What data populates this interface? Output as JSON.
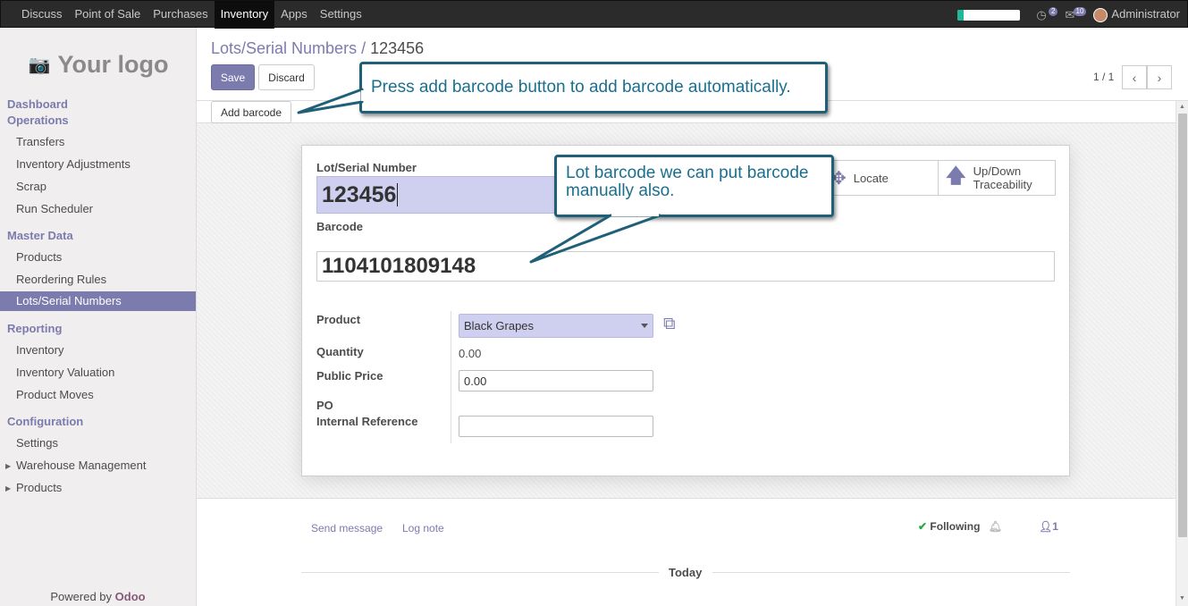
{
  "topbar": {
    "menu": [
      "Discuss",
      "Point of Sale",
      "Purchases",
      "Inventory",
      "Apps",
      "Settings"
    ],
    "active_menu": "Inventory",
    "progress_fraction": 0.1,
    "activities_count": "2",
    "messages_count": "10",
    "user": "Administrator"
  },
  "sidebar": {
    "logo_text": "Your logo",
    "sections": {
      "dashboard": "Dashboard",
      "operations": "Operations",
      "master_data": "Master Data",
      "reporting": "Reporting",
      "configuration": "Configuration"
    },
    "operations_items": [
      "Transfers",
      "Inventory Adjustments",
      "Scrap",
      "Run Scheduler"
    ],
    "master_data_items": [
      "Products",
      "Reordering Rules",
      "Lots/Serial Numbers"
    ],
    "reporting_items": [
      "Inventory",
      "Inventory Valuation",
      "Product Moves"
    ],
    "configuration_items": [
      "Settings",
      "Warehouse Management",
      "Products"
    ],
    "powered_by": "Powered by ",
    "powered_brand": "Odoo"
  },
  "breadcrumb": {
    "parent": "Lots/Serial Numbers /",
    "current": "123456"
  },
  "buttons": {
    "save": "Save",
    "discard": "Discard",
    "add_barcode": "Add barcode"
  },
  "pager": {
    "value": "1 / 1"
  },
  "form": {
    "lot_label": "Lot/Serial Number",
    "lot_value": "123456",
    "barcode_label": "Barcode",
    "barcode_value": "1104101809148",
    "locate_label": "Locate",
    "traceability_label": "Up/Down Traceability",
    "product_label": "Product",
    "product_value": "Black Grapes",
    "quantity_label": "Quantity",
    "quantity_value": "0.00",
    "public_price_label": "Public Price",
    "public_price_value": "0.00",
    "po_label": "PO",
    "internal_ref_label": "Internal Reference",
    "internal_ref_value": ""
  },
  "chatter": {
    "send_message": "Send message",
    "log_note": "Log note",
    "following": "Following",
    "followers_count": "1",
    "today": "Today"
  },
  "callouts": {
    "add_barcode_hint": "Press add barcode button to add barcode automatically.",
    "manual_barcode_hint": "Lot barcode we can put barcode manually also."
  },
  "colors": {
    "accent": "#7c7bad",
    "callout_border": "#1f5f78",
    "callout_text": "#1b6f8e"
  }
}
